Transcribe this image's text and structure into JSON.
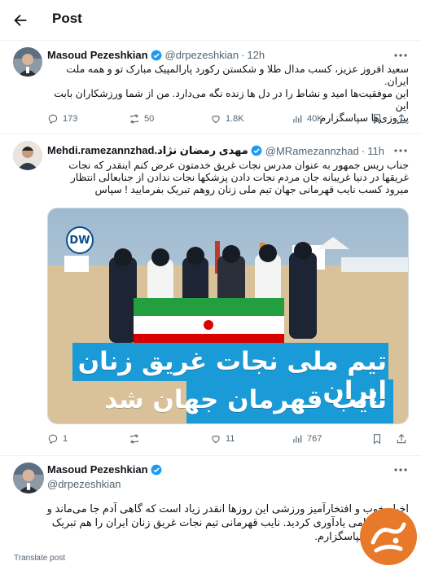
{
  "header": {
    "title": "Post"
  },
  "tweets": [
    {
      "name": "Masoud Pezeshkian",
      "handle": "@drpezeshkian",
      "time": "12h",
      "lines": [
        "سعید افروز عزیز، کسب مدال طلا و شکستن رکورد پارالمپیک مبارک تو و همه ملت ایران.",
        "این موفقیت‌ها امید و نشاط را در دل ها زنده نگه می‌دارد. من از شما ورزشکاران بابت این",
        "پیروزی‌ها سپاسگزارم"
      ],
      "replies": "173",
      "reposts": "50",
      "likes": "1.8K",
      "views": "40K"
    },
    {
      "name": "Mehdi.ramezannzhad.مهدی رمضان نژاد",
      "handle": "@MRamezannzhad",
      "time": "11h",
      "lines": [
        "جناب ریس جمهور به عنوان مدرس نجات غریق خدمتون عرض کنم اینقدر که نجات",
        "غریقها در دنیا غریبانه جان مردم نجات دادن پزشکها نجات ندادن از جنابعالی انتظار",
        "میرود کسب نایب قهرمانی جهان تیم ملی زنان روهم تبریک بفرمایید ! سپاس"
      ],
      "media": {
        "logo": "DW",
        "caption_line1": "تیم ملی نجات غریق زنان ایران",
        "caption_line2": "نایب قهرمان جهان شد"
      },
      "replies": "1",
      "reposts": "",
      "likes": "11",
      "views": "767"
    },
    {
      "name": "Masoud Pezeshkian",
      "handle": "@drpezeshkian",
      "lines": [
        "اخبار خوب و افتخارآمیز ورزشی این روزها انقدر زیاد است که گاهی آدم جا می‌ماند و",
        "دوست گرامی یادآوری کردید. نایب قهرمانی تیم نجات غریق زنان ایران را هم تبریک",
        "می‌گویم. سپاسگزارم."
      ]
    }
  ],
  "footer": {
    "translate": "Translate post"
  },
  "icons": {
    "back": "arrow-left-icon",
    "verified": "verified-badge-icon",
    "more": "more-icon",
    "reply": "reply-icon",
    "repost": "repost-icon",
    "like": "heart-icon",
    "views": "views-icon",
    "bookmark": "bookmark-icon",
    "share": "share-icon"
  },
  "colors": {
    "verified": "#1d9bf0",
    "text": "#0f1419",
    "muted": "#536471",
    "banner": "#1a9ad6",
    "watermark": "#e8792a"
  }
}
